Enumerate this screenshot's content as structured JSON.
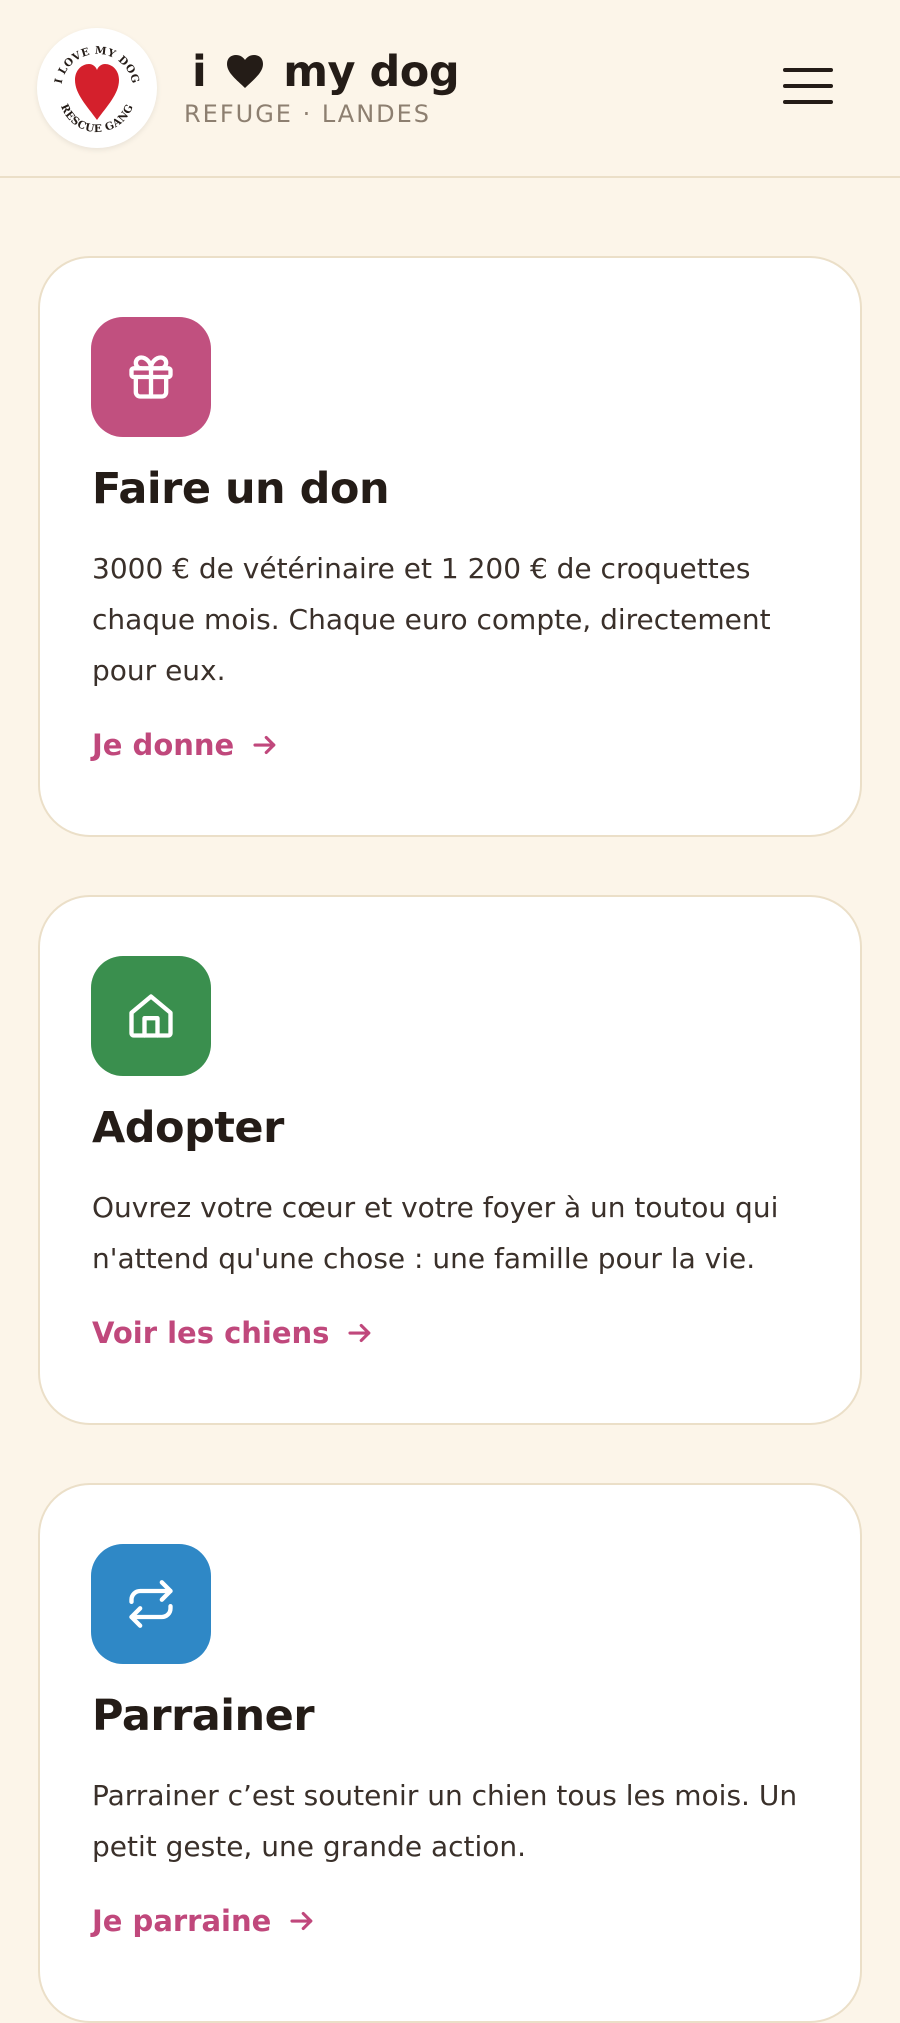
{
  "header": {
    "logo_icon": "rescue-gang-heart-logo",
    "logo_text_top": "I LOVE MY DOG",
    "logo_text_bottom": "RESCUE GANG",
    "brand_pre": "i",
    "brand_post": "my dog",
    "brand_heart_icon": "heart-icon",
    "subtitle": "REFUGE · LANDES",
    "menu_icon": "hamburger-menu-icon"
  },
  "cards": [
    {
      "icon": "gift-icon",
      "icon_color": "#c1507f",
      "title": "Faire un don",
      "text": "3000 € de vétérinaire et 1 200 € de croquettes chaque mois. Chaque euro compte, directement pour eux.",
      "link": "Je donne"
    },
    {
      "icon": "house-icon",
      "icon_color": "#3a8f4e",
      "title": "Adopter",
      "text": "Ouvrez votre cœur et votre foyer à un toutou qui n'attend qu'une chose : une famille pour la vie.",
      "link": "Voir les chiens"
    },
    {
      "icon": "repeat-arrows-icon",
      "icon_color": "#2f88c6",
      "title": "Parrainer",
      "text": "Parrainer c’est soutenir un chien tous les mois. Un petit geste, une grande action.",
      "link": "Je parraine"
    }
  ],
  "colors": {
    "background": "#fcf5e9",
    "accent": "#c0487c",
    "card_border": "#ebdfc8",
    "text": "#241c17"
  }
}
